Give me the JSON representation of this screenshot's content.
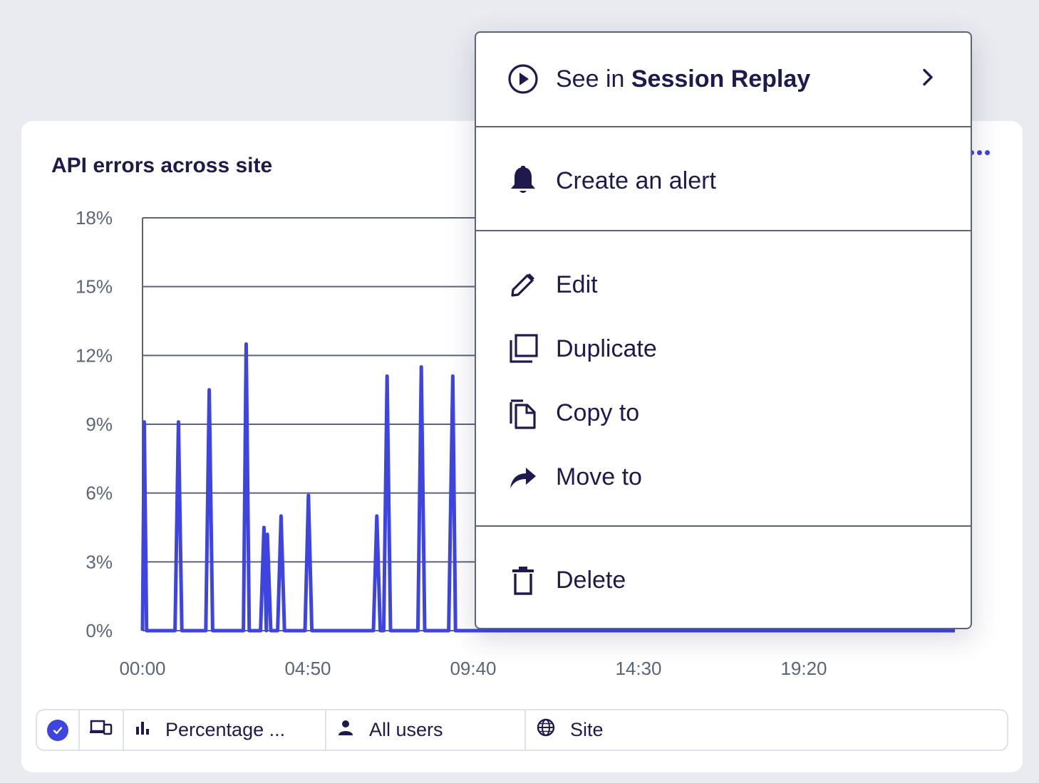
{
  "card": {
    "title": "API errors across site"
  },
  "chart_data": {
    "type": "line",
    "title": "API errors across site",
    "xlabel": "",
    "ylabel": "",
    "y_ticks": [
      "0%",
      "3%",
      "6%",
      "9%",
      "12%",
      "15%",
      "18%"
    ],
    "x_ticks": [
      "00:00",
      "04:50",
      "09:40",
      "14:30",
      "19:20"
    ],
    "ylim": [
      0,
      18
    ],
    "grid": true,
    "color": "#3d44e0",
    "series": [
      {
        "values": [
          [
            0.0,
            0
          ],
          [
            0.05,
            9.1
          ],
          [
            0.12,
            0
          ],
          [
            0.95,
            0
          ],
          [
            1.05,
            9.1
          ],
          [
            1.15,
            0
          ],
          [
            1.85,
            0
          ],
          [
            1.95,
            10.5
          ],
          [
            2.05,
            0
          ],
          [
            2.95,
            0
          ],
          [
            3.03,
            12.5
          ],
          [
            3.12,
            0
          ],
          [
            3.45,
            0
          ],
          [
            3.55,
            4.5
          ],
          [
            3.62,
            0
          ],
          [
            3.65,
            4.2
          ],
          [
            3.75,
            0
          ],
          [
            3.95,
            0
          ],
          [
            4.05,
            5.0
          ],
          [
            4.15,
            0
          ],
          [
            4.75,
            0
          ],
          [
            4.85,
            5.9
          ],
          [
            4.95,
            0
          ],
          [
            6.75,
            0
          ],
          [
            6.85,
            5.0
          ],
          [
            6.95,
            0
          ],
          [
            7.05,
            0
          ],
          [
            7.15,
            11.1
          ],
          [
            7.25,
            0
          ],
          [
            8.05,
            0
          ],
          [
            8.15,
            11.5
          ],
          [
            8.25,
            0
          ],
          [
            8.95,
            0
          ],
          [
            9.07,
            11.1
          ],
          [
            9.15,
            0
          ],
          [
            23.75,
            0
          ]
        ]
      }
    ]
  },
  "legend": {
    "metric": "Percentage ...",
    "users": "All users",
    "scope": "Site"
  },
  "menu": {
    "session_replay_prefix": "See in",
    "session_replay_bold": "Session Replay",
    "create_alert": "Create an alert",
    "edit": "Edit",
    "duplicate": "Duplicate",
    "copy_to": "Copy to",
    "move_to": "Move to",
    "delete": "Delete"
  },
  "colors": {
    "accent": "#3d44e0",
    "text": "#1f1a4d",
    "background": "#e9ebf0"
  }
}
